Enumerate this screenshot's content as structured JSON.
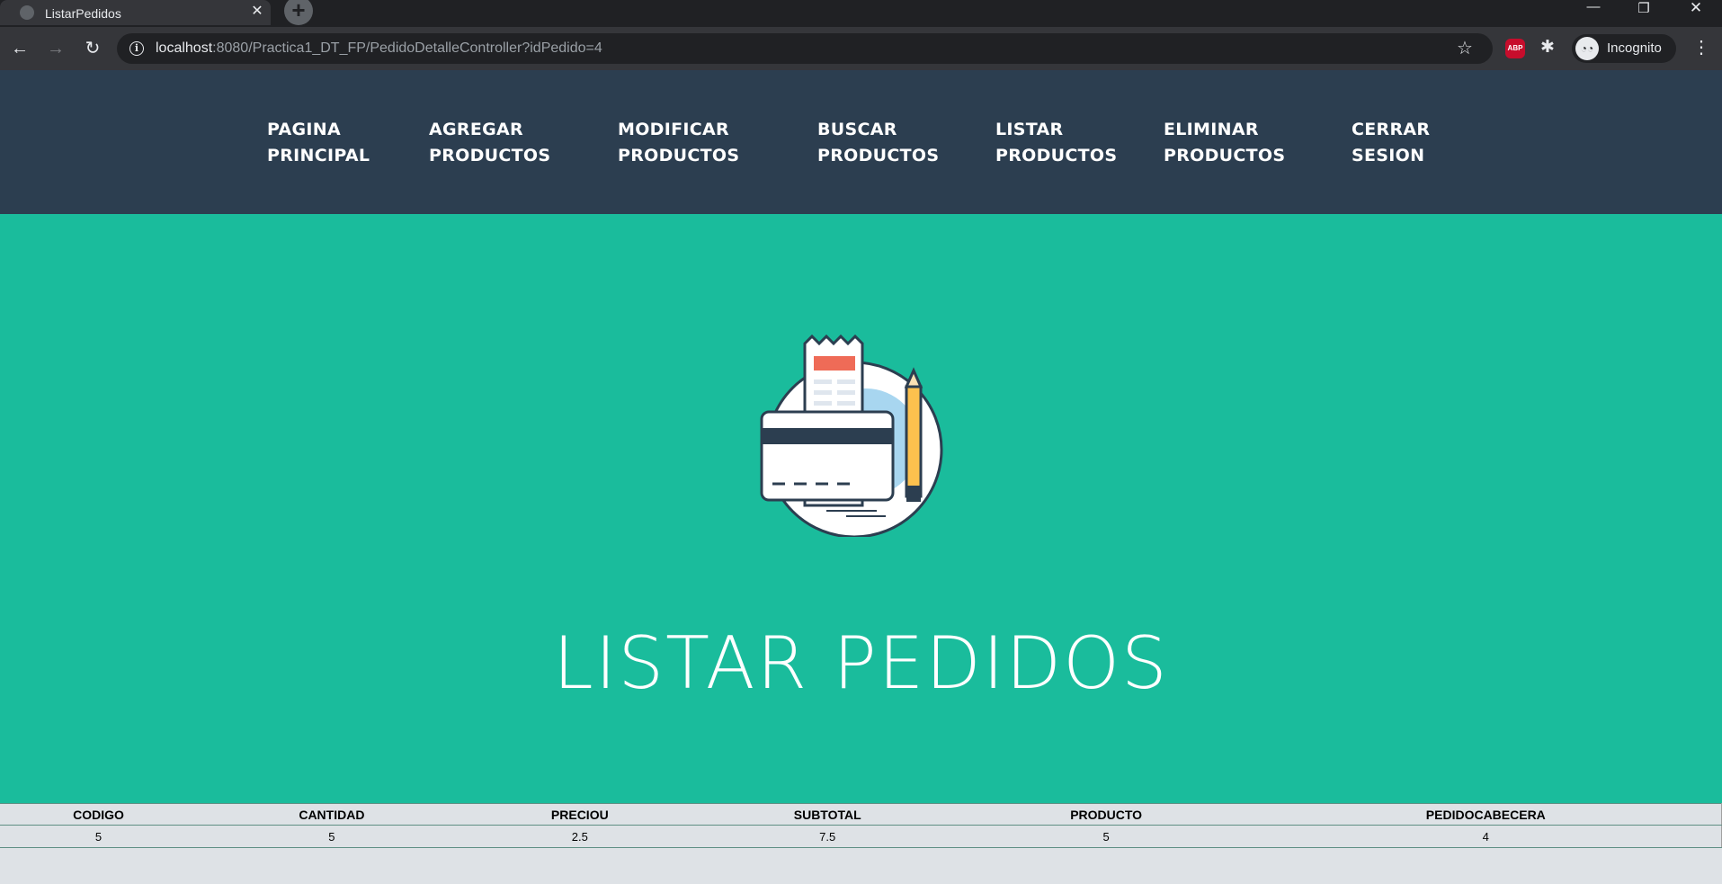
{
  "browser": {
    "tab_title": "ListarPedidos",
    "new_tab_label": "+",
    "url_host": "localhost",
    "url_rest": ":8080/Practica1_DT_FP/PedidoDetalleController?idPedido=4",
    "abp_label": "ABP",
    "profile_label": "Incognito"
  },
  "navbar": {
    "items": [
      {
        "line1": "PAGINA",
        "line2": "PRINCIPAL"
      },
      {
        "line1": "AGREGAR",
        "line2": "PRODUCTOS"
      },
      {
        "line1": "MODIFICAR",
        "line2": "PRODUCTOS"
      },
      {
        "line1": "BUSCAR",
        "line2": "PRODUCTOS"
      },
      {
        "line1": "LISTAR",
        "line2": "PRODUCTOS"
      },
      {
        "line1": "ELIMINAR",
        "line2": "PRODUCTOS"
      },
      {
        "line1": "CERRAR",
        "line2": "SESION"
      }
    ]
  },
  "masthead": {
    "heading": "LISTAR PEDIDOS"
  },
  "table": {
    "headers": [
      "CODIGO",
      "CANTIDAD",
      "PRECIOU",
      "SUBTOTAL",
      "PRODUCTO",
      "PEDIDOCABECERA"
    ],
    "rows": [
      [
        "5",
        "5",
        "2.5",
        "7.5",
        "5",
        "4"
      ]
    ]
  },
  "colors": {
    "navbar_bg": "#2c3e50",
    "masthead_bg": "#1abc9c",
    "table_bg": "#dee2e6"
  }
}
